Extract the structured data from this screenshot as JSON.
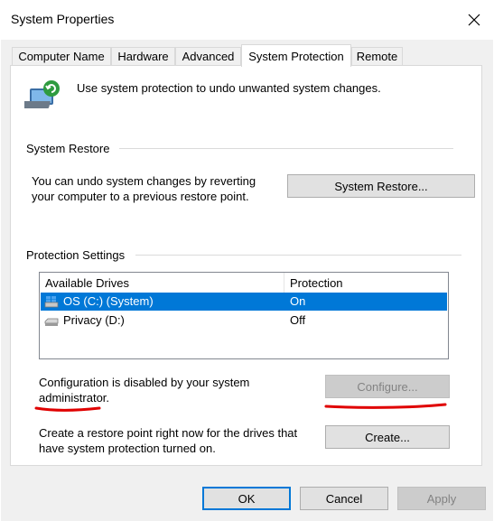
{
  "window": {
    "title": "System Properties"
  },
  "tabs": [
    {
      "label": "Computer Name"
    },
    {
      "label": "Hardware"
    },
    {
      "label": "Advanced"
    },
    {
      "label": "System Protection"
    },
    {
      "label": "Remote"
    }
  ],
  "header": {
    "description": "Use system protection to undo unwanted system changes."
  },
  "system_restore": {
    "group_title": "System Restore",
    "text_line1": "You can undo system changes by reverting",
    "text_line2": "your computer to a previous restore point.",
    "button_label": "System Restore..."
  },
  "protection": {
    "group_title": "Protection Settings",
    "columns": [
      "Available Drives",
      "Protection"
    ],
    "drives": [
      {
        "name": "OS (C:) (System)",
        "protection": "On",
        "selected": true
      },
      {
        "name": "Privacy (D:)",
        "protection": "Off",
        "selected": false
      }
    ],
    "config_text_line1": "Configuration is disabled by your system",
    "config_text_line2": "administrator.",
    "configure_label": "Configure...",
    "create_text_line1": "Create a restore point right now for the drives that",
    "create_text_line2": "have system protection turned on.",
    "create_label": "Create..."
  },
  "footer": {
    "ok_label": "OK",
    "cancel_label": "Cancel",
    "apply_label": "Apply"
  },
  "colors": {
    "accent": "#0078d7",
    "annotation": "#e00000",
    "panel_bg": "#f0f0f0"
  }
}
